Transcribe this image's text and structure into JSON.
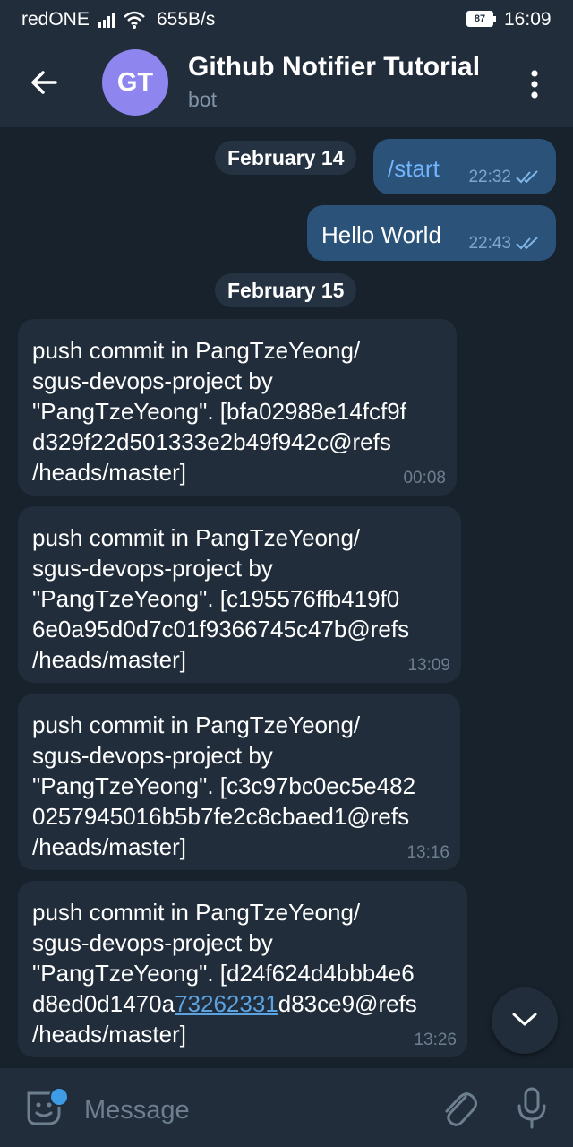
{
  "status_bar": {
    "carrier": "redONE",
    "speed": "655B/s",
    "battery": "87",
    "time": "16:09"
  },
  "header": {
    "avatar_initials": "GT",
    "avatar_color": "#8e85ee",
    "title": "Github Notifier Tutorial",
    "subtitle": "bot"
  },
  "dates": {
    "first": "February 14",
    "second": "February 15"
  },
  "outgoing": [
    {
      "text": "/start",
      "time": "22:32"
    },
    {
      "text": "Hello World",
      "time": "22:43"
    }
  ],
  "incoming": [
    {
      "line1": "push commit in PangTzeYeong/",
      "line2": "sgus-devops-project by",
      "line3": "\"PangTzeYeong\". [bfa02988e14fcf9f",
      "line4": "d329f22d501333e2b49f942c@refs",
      "line5": "/heads/master]",
      "time": "00:08"
    },
    {
      "line1": "push commit in PangTzeYeong/",
      "line2": "sgus-devops-project by",
      "line3": "\"PangTzeYeong\". [c195576ffb419f0",
      "line4": "6e0a95d0d7c01f9366745c47b@refs",
      "line5": "/heads/master]",
      "time": "13:09"
    },
    {
      "line1": "push commit in PangTzeYeong/",
      "line2": "sgus-devops-project by",
      "line3": "\"PangTzeYeong\". [c3c97bc0ec5e482",
      "line4": "0257945016b5b7fe2c8cbaed1@refs",
      "line5": "/heads/master]",
      "time": "13:16"
    },
    {
      "line1": "push commit in PangTzeYeong/",
      "line2": "sgus-devops-project by",
      "line3": "\"PangTzeYeong\". [d24f624d4bbb4e6",
      "line4_a": "d8ed0d1470a",
      "line4_link": "73262331",
      "line4_b": "d83ce9@refs",
      "line5": "/heads/master]",
      "time": "13:26"
    }
  ],
  "composer": {
    "placeholder": "Message"
  }
}
